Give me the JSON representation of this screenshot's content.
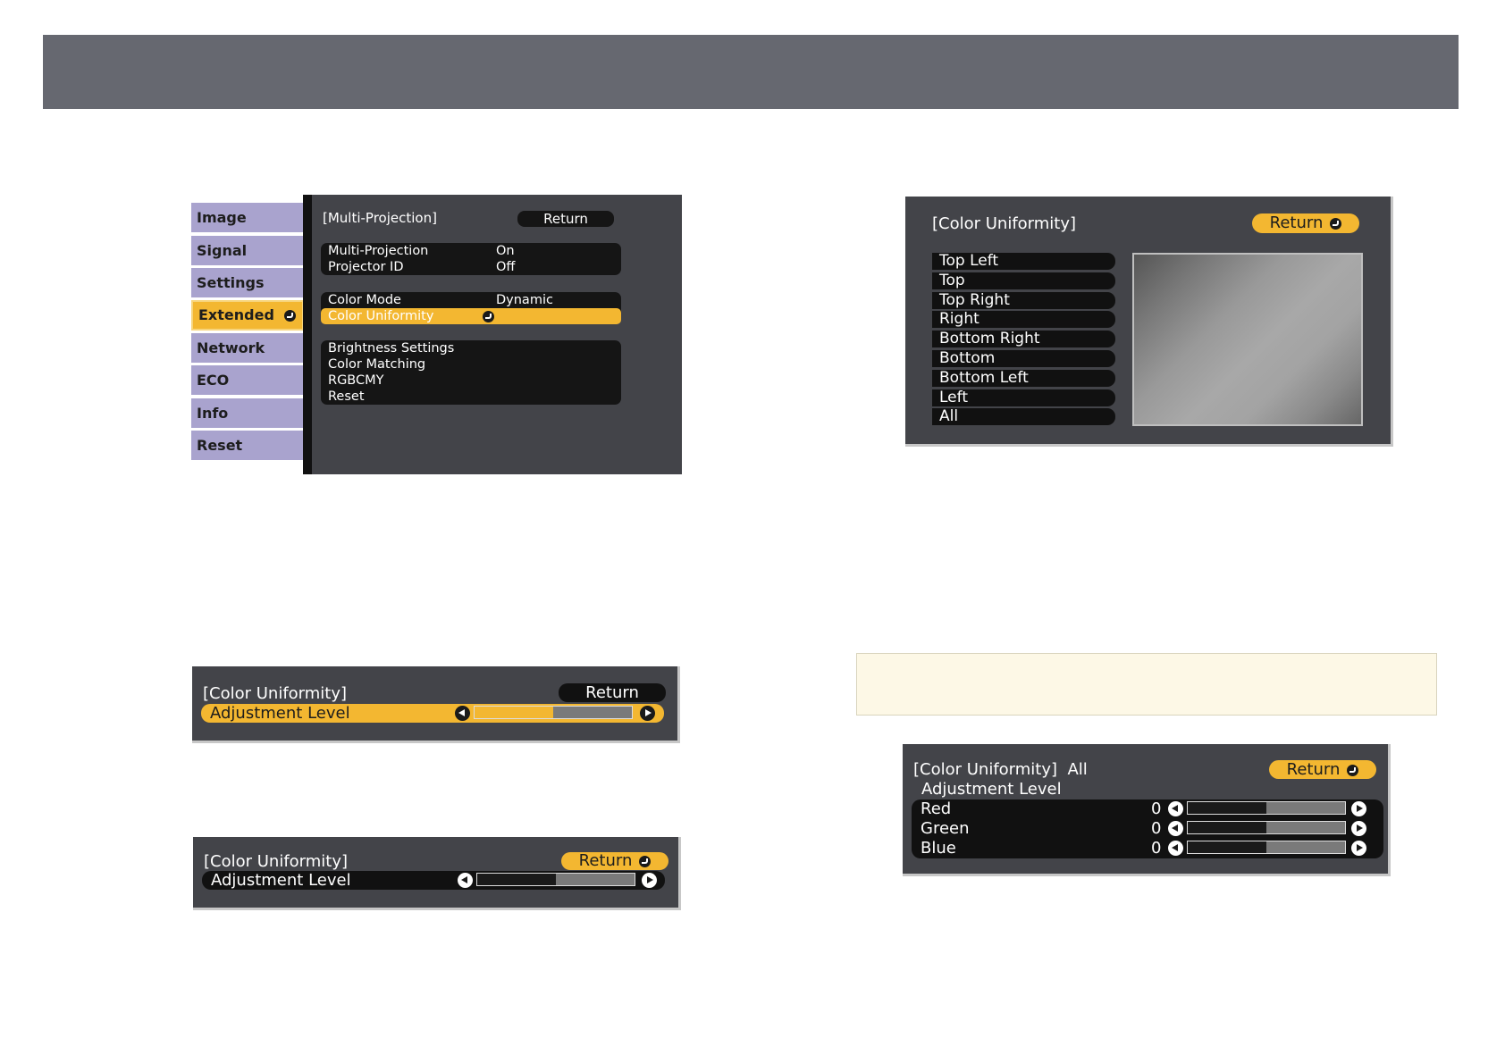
{
  "menu_main": {
    "tabs": [
      {
        "label": "Image"
      },
      {
        "label": "Signal"
      },
      {
        "label": "Settings"
      },
      {
        "label": "Extended"
      },
      {
        "label": "Network"
      },
      {
        "label": "ECO"
      },
      {
        "label": "Info"
      },
      {
        "label": "Reset"
      }
    ],
    "title": "[Multi-Projection]",
    "return_label": "Return",
    "groups": [
      [
        {
          "label": "Multi-Projection",
          "value": "On"
        },
        {
          "label": "Projector ID",
          "value": "Off"
        }
      ],
      [
        {
          "label": "Color Mode",
          "value": "Dynamic"
        },
        {
          "label": "Color Uniformity",
          "value": ""
        }
      ],
      [
        {
          "label": "Brightness Settings"
        },
        {
          "label": "Color Matching"
        },
        {
          "label": "RGBCMY"
        },
        {
          "label": "Reset"
        }
      ]
    ]
  },
  "cu_select": {
    "title": "[Color Uniformity]",
    "return_label": "Return",
    "areas": [
      "Top Left",
      "Top",
      "Top Right",
      "Right",
      "Bottom Right",
      "Bottom",
      "Bottom Left",
      "Left",
      "All"
    ]
  },
  "adj_panel_1": {
    "title": "[Color Uniformity]",
    "return_label": "Return",
    "row_label": "Adjustment Level",
    "level": 0.5
  },
  "adj_panel_2": {
    "title": "[Color Uniformity]",
    "return_label": "Return",
    "row_label": "Adjustment Level",
    "level": 0.5
  },
  "rgb_panel": {
    "title": "[Color Uniformity]",
    "area": "All",
    "subtitle": "Adjustment Level",
    "return_label": "Return",
    "rows": [
      {
        "label": "Red",
        "value": "0",
        "level": 0.5
      },
      {
        "label": "Green",
        "value": "0",
        "level": 0.5
      },
      {
        "label": "Blue",
        "value": "0",
        "level": 0.5
      }
    ]
  },
  "colors": {
    "highlight": "#f3b731",
    "tab": "#a9a3ce",
    "panel": "#434449",
    "header": "#666870"
  }
}
